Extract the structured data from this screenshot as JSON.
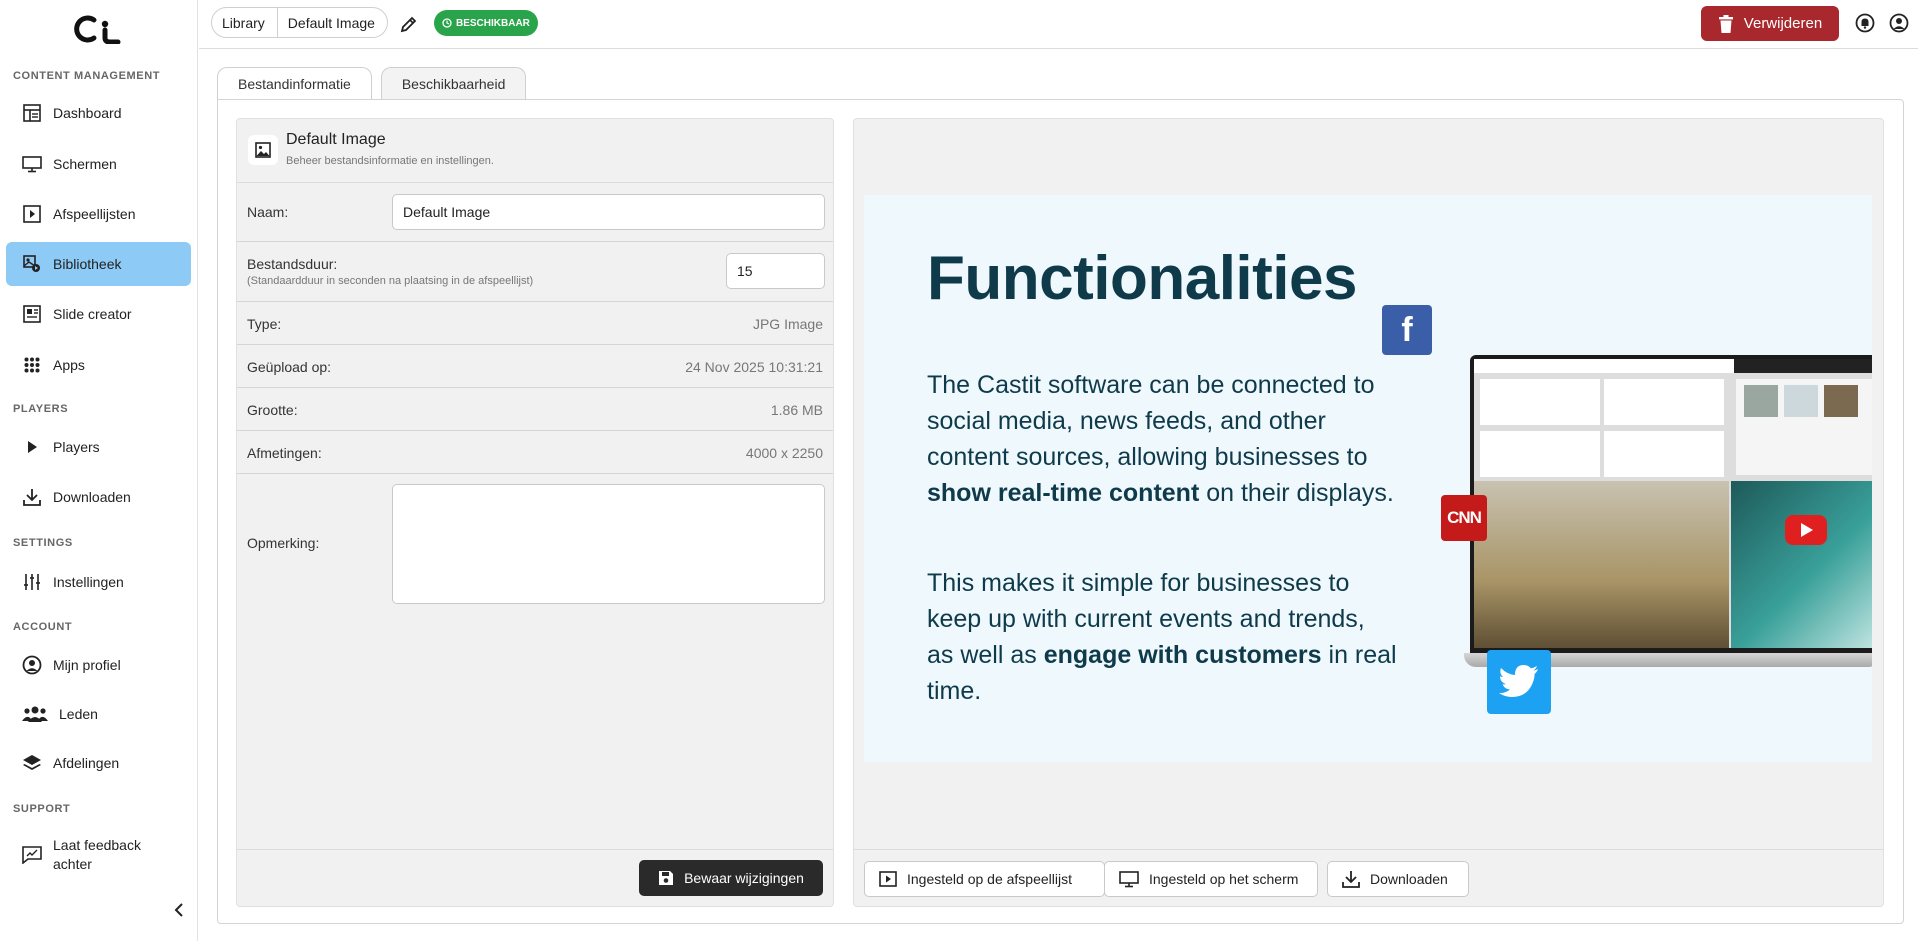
{
  "sidebar": {
    "sections": {
      "content_management": "CONTENT MANAGEMENT",
      "players": "PLAYERS",
      "settings": "SETTINGS",
      "account": "ACCOUNT",
      "support": "SUPPORT"
    },
    "items": {
      "dashboard": "Dashboard",
      "schermen": "Schermen",
      "afspeellijsten": "Afspeellijsten",
      "bibliotheek": "Bibliotheek",
      "slide_creator": "Slide creator",
      "apps": "Apps",
      "players": "Players",
      "downloaden": "Downloaden",
      "instellingen": "Instellingen",
      "mijn_profiel": "Mijn profiel",
      "leden": "Leden",
      "afdelingen": "Afdelingen",
      "feedback_line1": "Laat feedback",
      "feedback_line2": "achter"
    },
    "active_item": "bibliotheek",
    "active_color": "#8ecaf6"
  },
  "topbar": {
    "breadcrumb": [
      "Library",
      "Default Image"
    ],
    "status": "BESCHIKBAAR",
    "status_color": "#2aa44a",
    "delete_label": "Verwijderen",
    "delete_color": "#a8282d"
  },
  "tabs": [
    "Bestandinformatie",
    "Beschikbaarheid"
  ],
  "info_panel": {
    "title": "Default Image",
    "subtitle": "Beheer bestandsinformatie en instellingen.",
    "name_label": "Naam:",
    "name_value": "Default Image",
    "duration_label": "Bestandsduur:",
    "duration_hint": "(Standaardduur in seconden na plaatsing in de afspeellijst)",
    "duration_value": "15",
    "type_label": "Type:",
    "type_value": "JPG Image",
    "uploaded_label": "Geüpload op:",
    "uploaded_value": "24 Nov 2025 10:31:21",
    "size_label": "Grootte:",
    "size_value": "1.86 MB",
    "dimensions_label": "Afmetingen:",
    "dimensions_value": "4000 x 2250",
    "remark_label": "Opmerking:",
    "remark_value": "",
    "save_label": "Bewaar wijzigingen"
  },
  "preview": {
    "title": "Functionalities",
    "para1_a": "The Castit software can be connected to social media, news feeds, and other content sources, allowing businesses to ",
    "para1_bold": "show real-time content",
    "para1_b": " on their displays.",
    "para2_a": "This makes it simple for businesses to keep up with current events and trends, as well as ",
    "para2_bold": "engage with customers",
    "para2_b": " in real time.",
    "text_color": "#0f3a4a",
    "background_color": "#eef8fd"
  },
  "actions": {
    "playlist": "Ingesteld op de afspeellijst",
    "screen": "Ingesteld op het scherm",
    "download": "Downloaden"
  }
}
